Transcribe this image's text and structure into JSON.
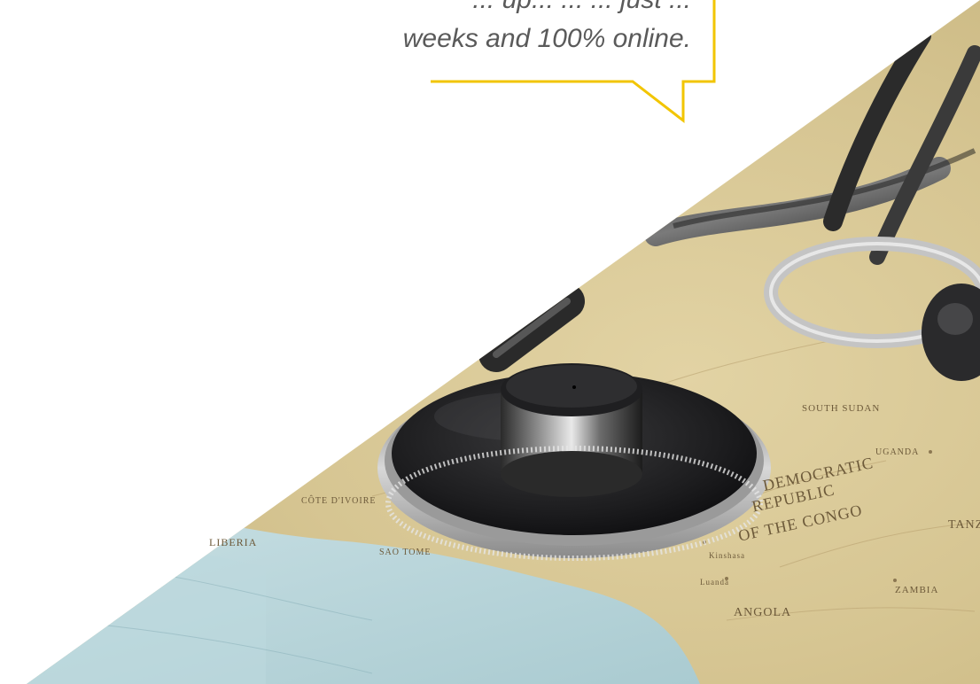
{
  "quote": {
    "line_1": "... up... ... ... just ...",
    "line_2": "weeks and 100% online."
  },
  "photo": {
    "subject": "stethoscope-on-map",
    "map_labels": {
      "liberia": "LIBERIA",
      "cote_divoire": "CÔTE D'IVOIRE",
      "sao_tome": "SAO TOME",
      "republic": "REPUBLIC",
      "drc_line_1": "DEMOCRATIC",
      "drc_line_3": "OF THE CONGO",
      "angola": "ANGOLA",
      "zambia": "ZAMBIA",
      "south_sudan": "SOUTH SUDAN",
      "uganda": "UGANDA",
      "tanzania": "TANZ",
      "kinshasa": "Kinshasa",
      "luanda": "Luanda"
    }
  },
  "colors": {
    "accent": "#f2c500",
    "quote_text": "#5a5a5a",
    "ocean": "#b9d7dc",
    "land": "#d8c99a"
  }
}
